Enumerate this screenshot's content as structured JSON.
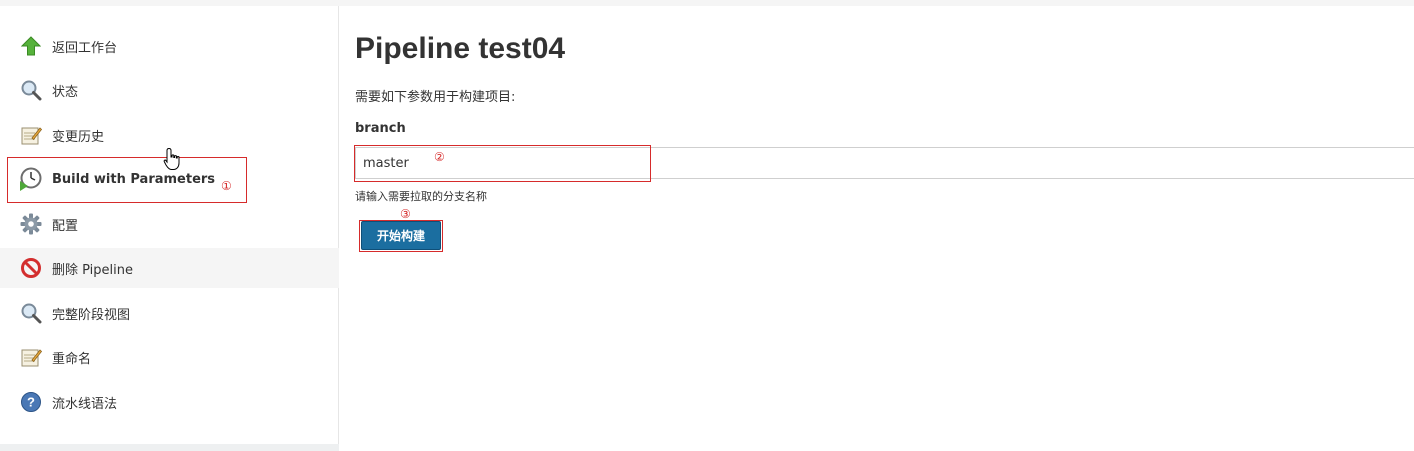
{
  "sidebar": {
    "items": [
      {
        "label": "返回工作台",
        "icon": "arrow-up-icon"
      },
      {
        "label": "状态",
        "icon": "magnifier-icon"
      },
      {
        "label": "变更历史",
        "icon": "notepad-icon"
      },
      {
        "label": "Build with Parameters",
        "icon": "clock-play-icon"
      },
      {
        "label": "配置",
        "icon": "gear-icon"
      },
      {
        "label": "删除 Pipeline",
        "icon": "no-entry-icon"
      },
      {
        "label": "完整阶段视图",
        "icon": "magnifier-icon"
      },
      {
        "label": "重命名",
        "icon": "notepad-icon"
      },
      {
        "label": "流水线语法",
        "icon": "help-icon"
      }
    ]
  },
  "main": {
    "title": "Pipeline test04",
    "description": "需要如下参数用于构建项目:",
    "parameter": {
      "name": "branch",
      "value": "master",
      "help": "请输入需要拉取的分支名称"
    },
    "build_button_label": "开始构建"
  },
  "annotations": {
    "mark1": "①",
    "mark2": "②",
    "mark3": "③"
  },
  "colors": {
    "annotation_red": "#d62b2b",
    "button_blue": "#1b6ea0",
    "hover_row": "#f5f5f5"
  }
}
